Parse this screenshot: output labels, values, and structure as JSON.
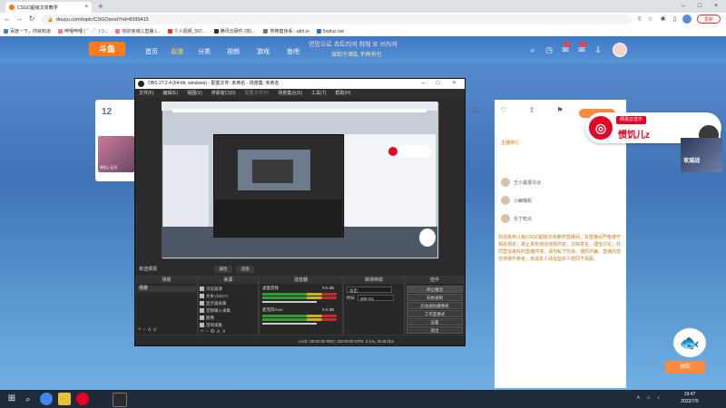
{
  "browser": {
    "tab_title": "CSGO超级文体教学",
    "url": "douyu.com/topic/CSGOsnot?rid=8399415",
    "update_label": "更新",
    "bookmarks": [
      "百度一下，你就知道",
      "哔哩哔哩 ( ゜- ゜)つ...",
      "你的宫城儿直播 (...",
      "个人视频_597…",
      "腾讯云硬件 (攻)…",
      "脊椎健身系 - abrt.io",
      "5eplus.net"
    ]
  },
  "douyu": {
    "logo": "斗鱼",
    "nav": [
      "首页",
      "直播",
      "分类",
      "视频",
      "游戏",
      "鱼吧"
    ],
    "danmaku": [
      "영망으로 흐트러져 취해 또 쓰러져",
      "深知于酒乱 不再有引"
    ],
    "count": "12",
    "streamer_label": "单机 | 石鸟",
    "rank_title": "主播排行",
    "rank_users": [
      "王小黑很冷淡",
      "小幽喵机",
      "乐了吃瓜"
    ],
    "chat_text": "欢迎来到斗鱼CSGO超级文体教学直播间，本直播间严格遵守相关规定，禁止发布违法违规内容，文明发言，理性讨论，共同营造良好的直播环境。请勿私下交易，谨防诈骗。直播内容仅供娱乐参考，未成年人请在监护人陪同下观看。",
    "bonus_label": "抽奖"
  },
  "netease": {
    "label": "网易云音乐",
    "song": "惯饥儿z",
    "game_label": "攻城战"
  },
  "obs": {
    "title": "OBS 27.2.4 (64-bit, windows) - 配置文件: 未命名 - 场景集: 未命名",
    "menu": [
      "文件(F)",
      "编辑(E)",
      "视图(V)",
      "停靠窗口(D)",
      "配置文件(P)",
      "场景集合(S)",
      "工具(T)",
      "帮助(H)"
    ],
    "scene_bar_label": "未选择源",
    "filter_btns": [
      "属性",
      "滤镜"
    ],
    "docks": {
      "scenes": "场景",
      "sources": "来源",
      "mixer": "混音器",
      "transitions": "转场特效",
      "controls": "控件"
    },
    "scene_item": "场景",
    "sources": [
      "浏览器源",
      "文本 (GDI+)",
      "显示器采集",
      "音频输入采集",
      "图像",
      "游戏采集"
    ],
    "mixer": {
      "ch1": "桌面音频",
      "ch2": "麦克风/Aux",
      "ch1_db": "0.0 dB",
      "ch2_db": "0.0 dB"
    },
    "transition": {
      "type": "淡出",
      "dur_label": "时长",
      "dur_value": "300 ms"
    },
    "controls": [
      "停止推流",
      "开始录制",
      "启动虚拟摄像机",
      "工作室模式",
      "设置",
      "退出"
    ],
    "status": "LIVE: 00:00:00    REC: 00:00:00    CPU: 2.1%, 30.00 fps"
  },
  "taskbar": {
    "time": "19:47",
    "date": "2022/7/5"
  }
}
